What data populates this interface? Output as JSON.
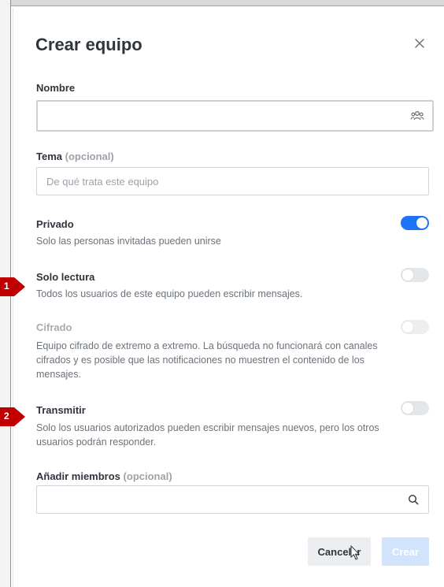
{
  "dialog": {
    "title": "Crear equipo"
  },
  "fields": {
    "name": {
      "label": "Nombre",
      "value": "",
      "icon": "team-icon"
    },
    "topic": {
      "label": "Tema",
      "optional": "(opcional)",
      "placeholder": "De qué trata este equipo"
    },
    "members": {
      "label": "Añadir miembros",
      "optional": "(opcional)",
      "value": "",
      "icon": "search-icon"
    }
  },
  "options": {
    "private": {
      "label": "Privado",
      "description": "Solo las personas invitadas pueden unirse",
      "state": "on"
    },
    "readonly": {
      "label": "Solo lectura",
      "description": "Todos los usuarios de este equipo pueden escribir mensajes.",
      "state": "off"
    },
    "encrypted": {
      "label": "Cifrado",
      "description": "Equipo cifrado de extremo a extremo. La búsqueda no funcionará con canales cifrados y es posible que las notificaciones no muestren el contenido de los mensajes.",
      "state": "off-disabled"
    },
    "broadcast": {
      "label": "Transmitir",
      "description": "Solo los usuarios autorizados pueden escribir mensajes nuevos, pero los otros usuarios podrán responder.",
      "state": "off"
    }
  },
  "buttons": {
    "cancel": "Cancelar",
    "create": "Crear"
  },
  "markers": [
    "1",
    "2"
  ],
  "colors": {
    "accent": "#1d74f5",
    "create_disabled": "#d1e3fd",
    "marker": "#c00000"
  }
}
